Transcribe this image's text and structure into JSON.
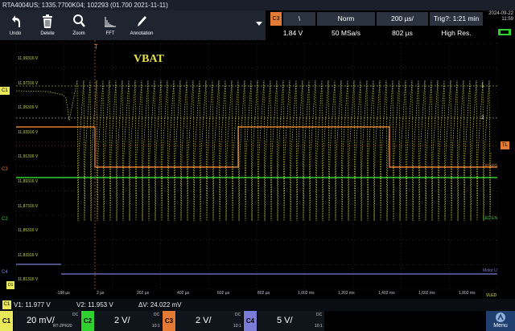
{
  "title": "RTA4004US; 1335.7700K04; 102293 (01.700 2021-11-11)",
  "toolbar": {
    "undo": "Undo",
    "delete": "Delete",
    "zoom": "Zoom",
    "fft": "FFT",
    "annotation": "Annotation"
  },
  "acquisition": {
    "trigger_source": "C3",
    "slope": "\\",
    "mode": "Norm",
    "timebase": "200 µs/",
    "trig_time": "Trig?: 1:21 min",
    "level": "1.84 V",
    "sample_rate": "50 MSa/s",
    "offset": "802 µs",
    "resolution": "High Res.",
    "date": "2024-09-22",
    "time": "11:59"
  },
  "waveform": {
    "label": "VBAT",
    "colors": {
      "c1": "#e8e85a",
      "c2": "#2fd12f",
      "c3": "#e37b34",
      "c4": "#7b7bd8"
    },
    "y_labels": [
      "11,99316 V",
      "11,97316 V",
      "11,95316 V",
      "11,93316 V",
      "11,91316 V",
      "11,89316 V",
      "11,87316 V",
      "11,85316 V",
      "11,83316 V",
      "11,81316 V"
    ],
    "x_labels": [
      "-198 µs",
      "2 µs",
      "202 µs",
      "402 µs",
      "602 µs",
      "802 µs",
      "1,002 ms",
      "1,202 ms",
      "1,402 ms",
      "1,602 ms",
      "1,802 ms"
    ],
    "markers": {
      "c1": "C1",
      "c3": "C3",
      "c2": "C2",
      "c4": "C4",
      "trigger": "T",
      "tl": "TL",
      "cursor1": "1",
      "cursor2": "2",
      "led_pg": "LED PG",
      "led_en": "LED EN",
      "motor_u": "Motor U",
      "vled": "VLED",
      "d1": "D1"
    }
  },
  "cursor": {
    "channel": "C1",
    "v1": "V1: 11.977 V",
    "v2": "V2: 11.953 V",
    "dv": "ΔV: 24.022 mV"
  },
  "channels": [
    {
      "tag": "C1",
      "value": "20 mV/",
      "coupling": "DC",
      "probe": "RT-ZPR20",
      "color": "#e8e85a"
    },
    {
      "tag": "C2",
      "value": "2 V/",
      "coupling": "DC",
      "probe": "10:1",
      "color": "#2fd12f"
    },
    {
      "tag": "C3",
      "value": "2 V/",
      "coupling": "DC",
      "probe": "10:1",
      "color": "#e37b34"
    },
    {
      "tag": "C4",
      "value": "5 V/",
      "coupling": "DC",
      "probe": "10:1",
      "color": "#7b7bd8"
    }
  ],
  "menu_label": "Menu"
}
